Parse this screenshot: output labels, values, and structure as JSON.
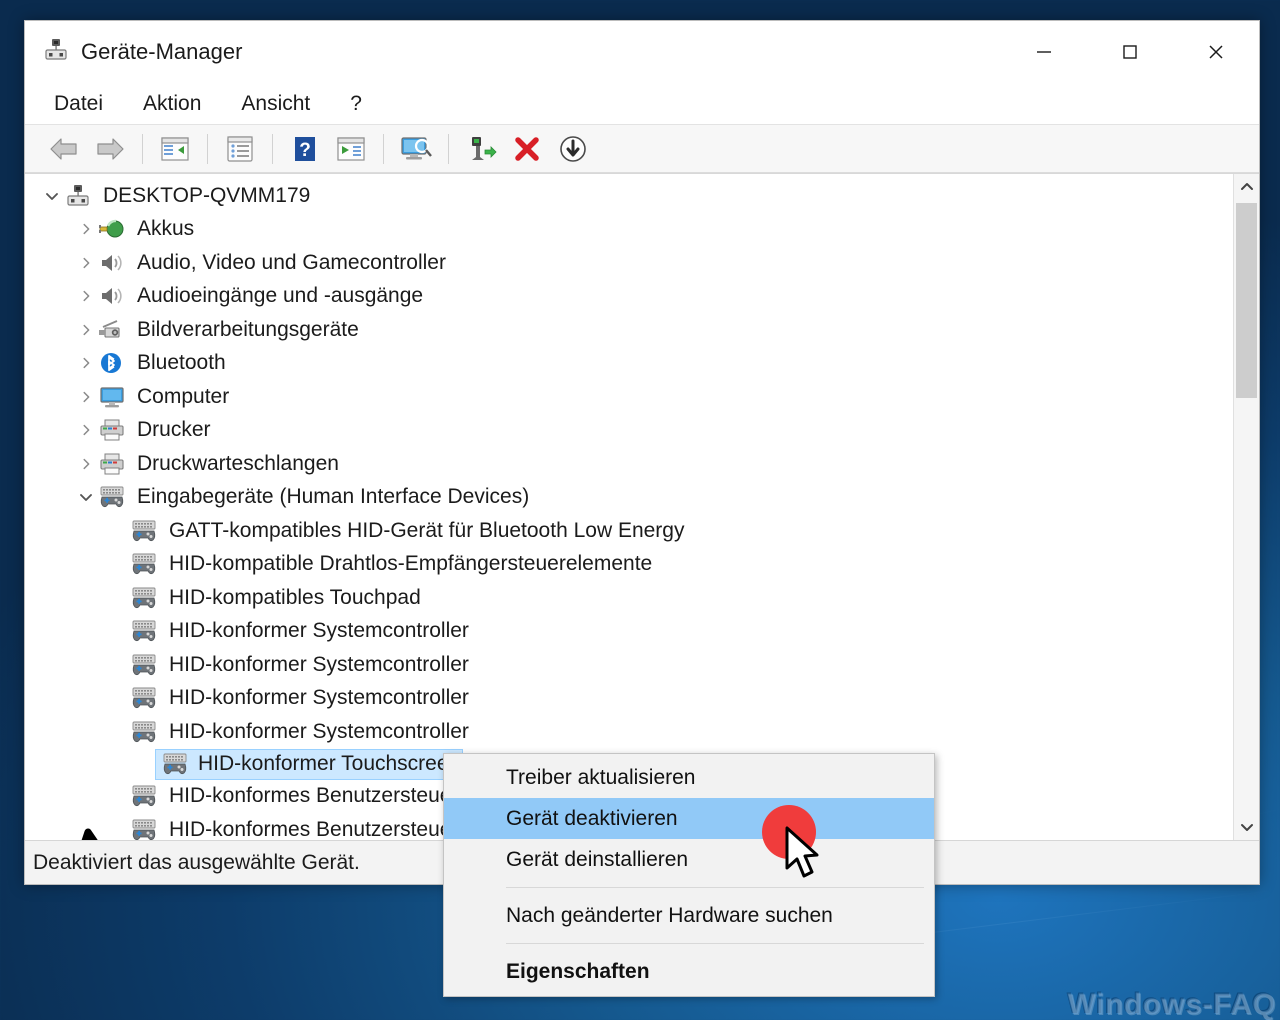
{
  "desktop": {
    "watermark": "Windows-FAQ",
    "background_color": "#0d3c6a"
  },
  "window": {
    "title": "Geräte-Manager",
    "icon": "device-manager-icon",
    "controls": {
      "minimize": "−",
      "maximize": "□",
      "close": "✕"
    }
  },
  "menubar": {
    "items": [
      {
        "label": "Datei",
        "name": "menu-datei"
      },
      {
        "label": "Aktion",
        "name": "menu-aktion"
      },
      {
        "label": "Ansicht",
        "name": "menu-ansicht"
      },
      {
        "label": "?",
        "name": "menu-hilfe"
      }
    ]
  },
  "toolbar": {
    "buttons": [
      {
        "name": "back-icon",
        "tip": "Zurück"
      },
      {
        "name": "forward-icon",
        "tip": "Vorwärts"
      },
      {
        "name": "show-hide-console-tree-icon",
        "tip": "Konsolenstruktur ein-/ausblenden"
      },
      {
        "name": "properties-icon",
        "tip": "Eigenschaften"
      },
      {
        "name": "help-icon",
        "tip": "Hilfe"
      },
      {
        "name": "update-driver-icon",
        "tip": "Treiber aktualisieren"
      },
      {
        "name": "scan-hardware-changes-icon",
        "tip": "Nach geänderter Hardware suchen"
      },
      {
        "name": "enable-device-icon",
        "tip": "Gerät aktivieren"
      },
      {
        "name": "uninstall-device-icon",
        "tip": "Gerät deinstallieren"
      },
      {
        "name": "disable-device-icon",
        "tip": "Gerät deaktivieren"
      }
    ]
  },
  "tree": {
    "root": {
      "label": "DESKTOP-QVMM179",
      "icon": "computer-root-icon",
      "expanded": true
    },
    "categories": [
      {
        "label": "Akkus",
        "icon": "battery-icon",
        "expanded": false
      },
      {
        "label": "Audio, Video und Gamecontroller",
        "icon": "speaker-icon",
        "expanded": false
      },
      {
        "label": "Audioeingänge und -ausgänge",
        "icon": "speaker-icon",
        "expanded": false
      },
      {
        "label": "Bildverarbeitungsgeräte",
        "icon": "camera-icon",
        "expanded": false
      },
      {
        "label": "Bluetooth",
        "icon": "bluetooth-icon",
        "expanded": false
      },
      {
        "label": "Computer",
        "icon": "monitor-icon",
        "expanded": false
      },
      {
        "label": "Drucker",
        "icon": "printer-icon",
        "expanded": false
      },
      {
        "label": "Druckwarteschlangen",
        "icon": "printer-icon",
        "expanded": false
      },
      {
        "label": "Eingabegeräte (Human Interface Devices)",
        "icon": "hid-icon",
        "expanded": true
      }
    ],
    "devices": [
      {
        "label": "GATT-kompatibles HID-Gerät für Bluetooth Low Energy",
        "icon": "hid-icon",
        "selected": false
      },
      {
        "label": "HID-kompatible Drahtlos-Empfängersteuerelemente",
        "icon": "hid-icon",
        "selected": false
      },
      {
        "label": "HID-kompatibles Touchpad",
        "icon": "hid-icon",
        "selected": false
      },
      {
        "label": "HID-konformer Systemcontroller",
        "icon": "hid-icon",
        "selected": false
      },
      {
        "label": "HID-konformer Systemcontroller",
        "icon": "hid-icon",
        "selected": false
      },
      {
        "label": "HID-konformer Systemcontroller",
        "icon": "hid-icon",
        "selected": false
      },
      {
        "label": "HID-konformer Systemcontroller",
        "icon": "hid-icon",
        "selected": false
      },
      {
        "label": "HID-konformer Touchscreen",
        "icon": "hid-icon",
        "selected": true
      },
      {
        "label": "HID-konformes Benutzersteuergerät",
        "icon": "hid-icon",
        "selected": false
      },
      {
        "label": "HID-konformes Benutzersteuergerät",
        "icon": "hid-icon",
        "selected": false
      }
    ],
    "selection_color": "#cce8ff"
  },
  "context_menu": {
    "highlight_color": "#91c9f7",
    "items": [
      {
        "label": "Treiber aktualisieren",
        "name": "ctx-update-driver",
        "highlighted": false,
        "bold": false
      },
      {
        "label": "Gerät deaktivieren",
        "name": "ctx-disable-device",
        "highlighted": true,
        "bold": false
      },
      {
        "label": "Gerät deinstallieren",
        "name": "ctx-uninstall-device",
        "highlighted": false,
        "bold": false
      },
      {
        "label": "Nach geänderter Hardware suchen",
        "name": "ctx-scan-hardware",
        "highlighted": false,
        "bold": false
      },
      {
        "label": "Eigenschaften",
        "name": "ctx-properties",
        "highlighted": false,
        "bold": true
      }
    ]
  },
  "statusbar": {
    "text": "Deaktiviert das ausgewählte Gerät."
  },
  "annotations": {
    "arrow_name": "pointer-annotation-arrow",
    "click_dot_color": "#f03c3c"
  },
  "scrollbar": {
    "up_arrow": "chevron-up-icon",
    "down_arrow": "chevron-down-icon"
  }
}
